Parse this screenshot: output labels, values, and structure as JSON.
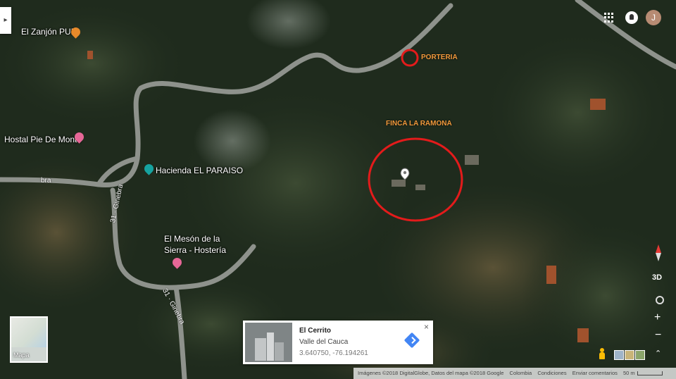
{
  "places": {
    "zanjon": "El Zanjón PUB",
    "hostal": "Hostal Pie De Monte",
    "hacienda": "Hacienda EL PARAISO",
    "meson_line1": "El Mesón de la",
    "meson_line2": "Sierra - Hostería"
  },
  "roads": {
    "bra": "bra",
    "ginebra_a": "31 · Ginebra",
    "ginebra_b": "31 · Ginebra"
  },
  "annotations": {
    "porteria": "PORTERIA",
    "finca": "FINCA LA RAMONA"
  },
  "colors": {
    "annotation": "#f29a3c",
    "circle": "#e31b1b",
    "pin_pink": "#e66797",
    "pin_teal": "#16a3a0"
  },
  "header": {
    "left_tab": "▸",
    "avatar_initial": "J"
  },
  "mapa_label": "Mapa",
  "place_card": {
    "title": "El Cerrito",
    "subtitle": "Valle del Cauca",
    "coordinates": "3.640750, -76.194261",
    "close": "×"
  },
  "controls": {
    "three_d": "3D",
    "zoom_in": "+",
    "zoom_out": "−",
    "expand": "⌃"
  },
  "footer": {
    "imagery": "Imágenes ©2018 DigitalGlobe, Datos del mapa ©2018 Google",
    "country": "Colombia",
    "terms": "Condiciones",
    "feedback": "Enviar comentarios",
    "scale": "50 m"
  }
}
